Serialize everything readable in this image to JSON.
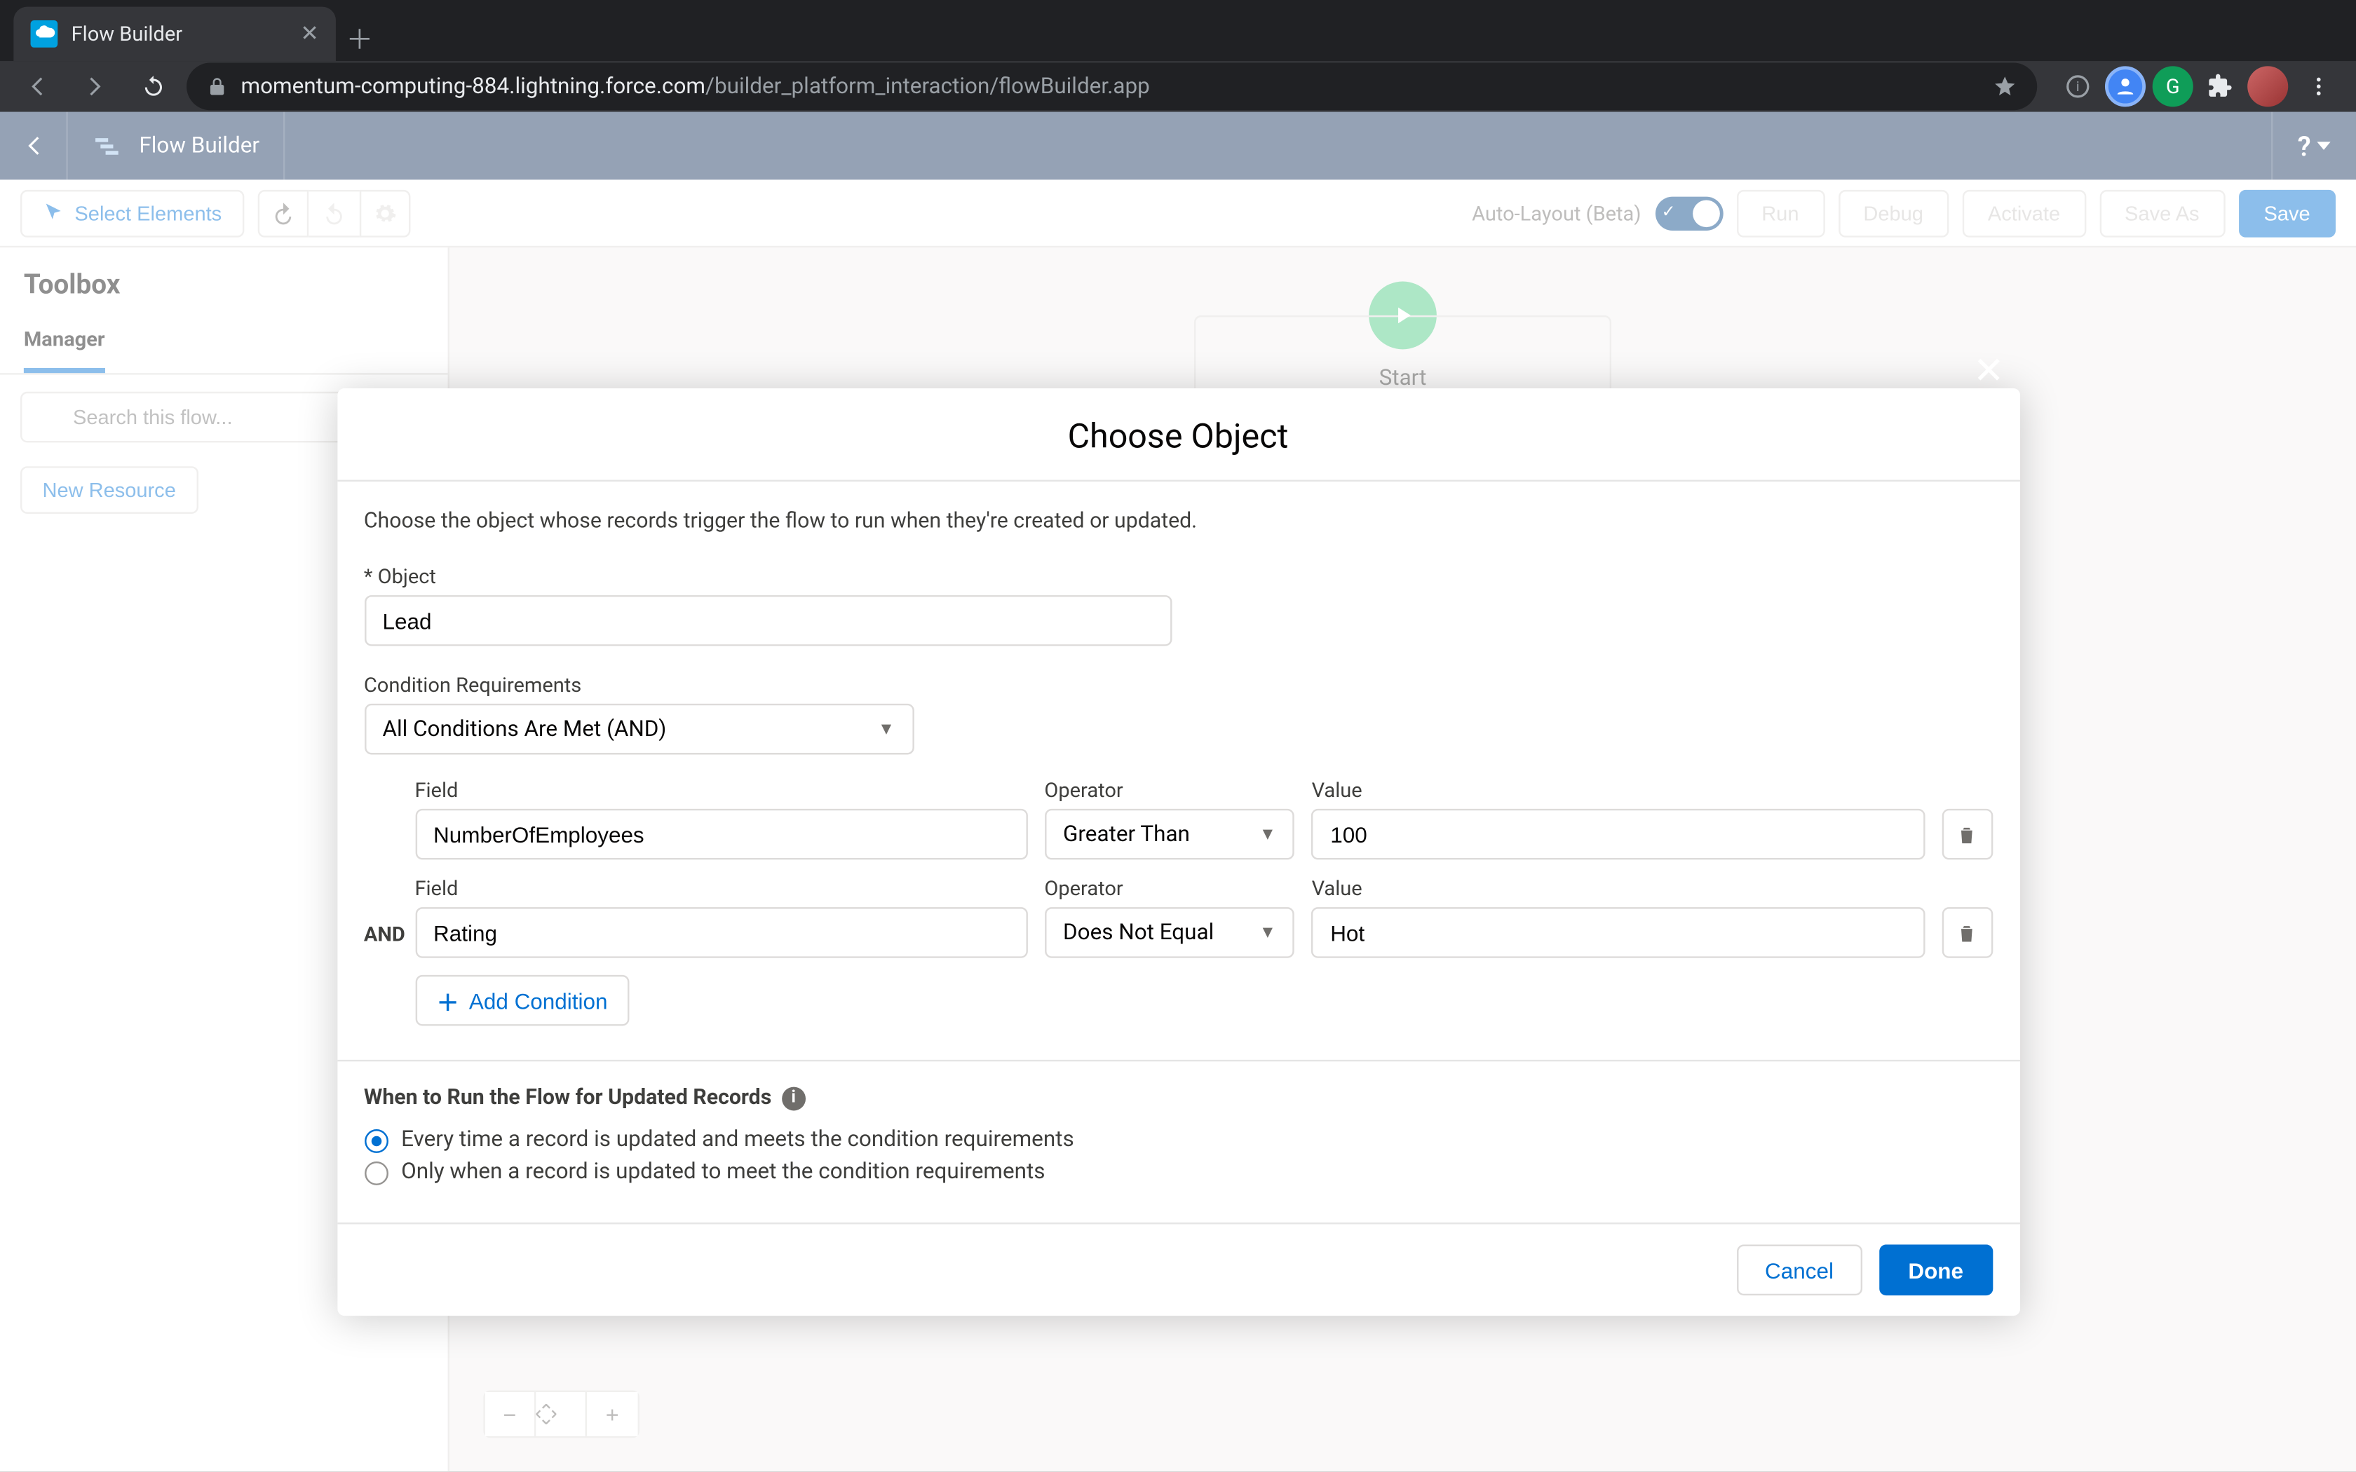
{
  "browser": {
    "tab_title": "Flow Builder",
    "url_host": "momentum-computing-884.lightning.force.com",
    "url_path": "/builder_platform_interaction/flowBuilder.app"
  },
  "app": {
    "back_aria": "Back",
    "title": "Flow Builder",
    "help_label": "?"
  },
  "toolbar": {
    "select_elements": "Select Elements",
    "auto_layout": "Auto-Layout (Beta)",
    "run": "Run",
    "debug": "Debug",
    "activate": "Activate",
    "save_as": "Save As",
    "save": "Save"
  },
  "sidebar": {
    "toolbox": "Toolbox",
    "manager_tab": "Manager",
    "search_placeholder": "Search this flow...",
    "new_resource": "New Resource"
  },
  "canvas": {
    "start_label": "Start"
  },
  "modal": {
    "title": "Choose Object",
    "help": "Choose the object whose records trigger the flow to run when they're created or updated.",
    "object_label": "Object",
    "object_value": "Lead",
    "cond_req_label": "Condition Requirements",
    "cond_req_value": "All Conditions Are Met (AND)",
    "columns": {
      "field": "Field",
      "operator": "Operator",
      "value": "Value"
    },
    "and_label": "AND",
    "conditions": [
      {
        "field": "NumberOfEmployees",
        "operator": "Greater Than",
        "value": "100"
      },
      {
        "field": "Rating",
        "operator": "Does Not Equal",
        "value": "Hot"
      }
    ],
    "add_condition": "Add Condition",
    "when_heading": "When to Run the Flow for Updated Records",
    "radio_a": "Every time a record is updated and meets the condition requirements",
    "radio_b": "Only when a record is updated to meet the condition requirements",
    "cancel": "Cancel",
    "done": "Done"
  }
}
